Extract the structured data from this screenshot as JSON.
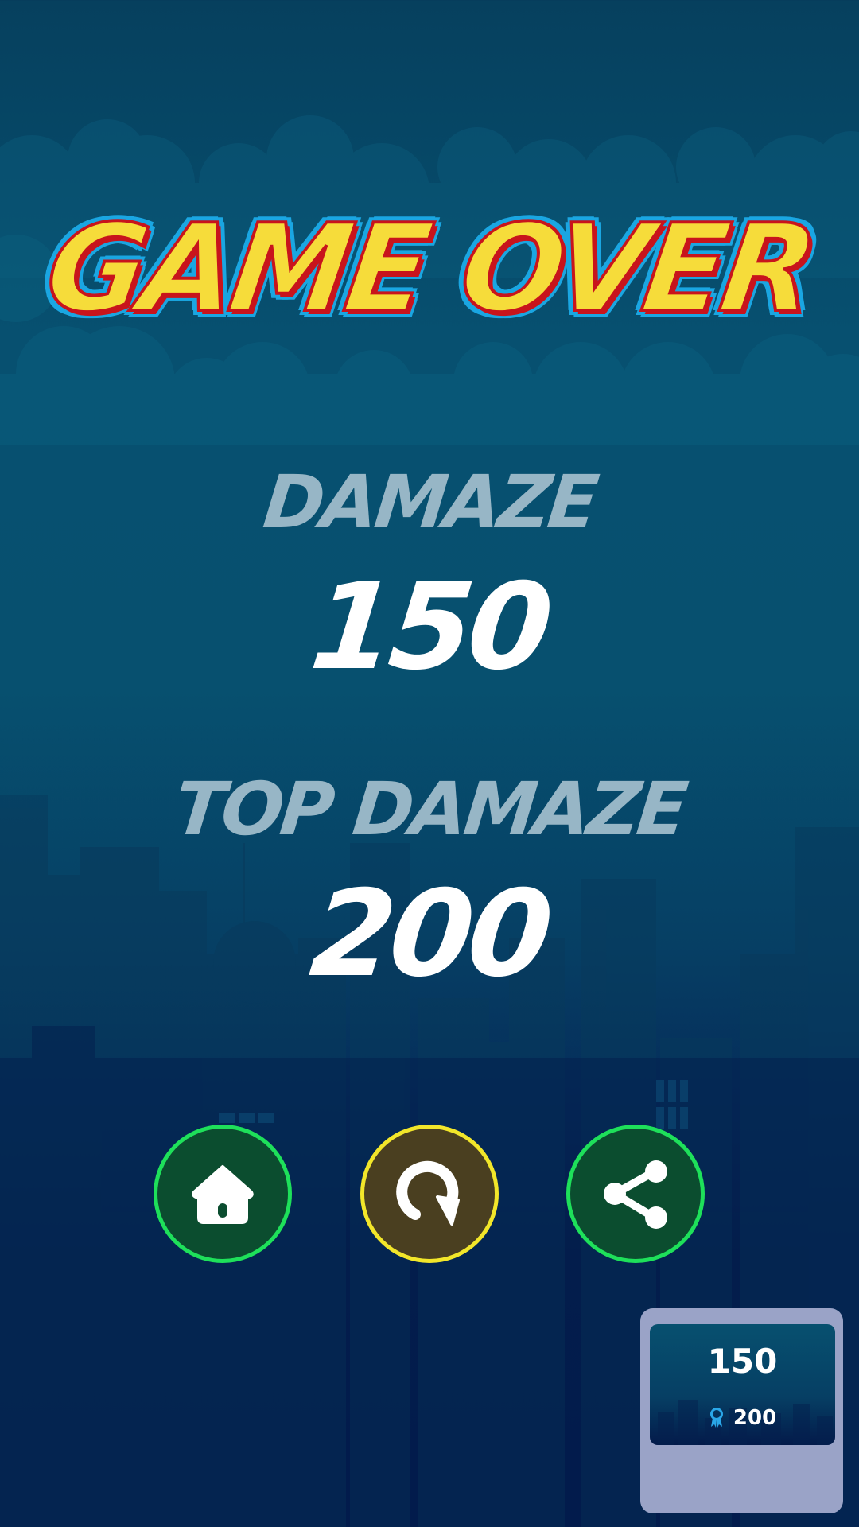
{
  "screen": {
    "title": "GAME OVER",
    "score_label": "DAMAZE",
    "score_value": "150",
    "top_label": "TOP DAMAZE",
    "top_value": "200"
  },
  "buttons": [
    {
      "id": "home",
      "icon": "home-icon",
      "ring_color": "#1ee05a"
    },
    {
      "id": "restart",
      "icon": "restart-icon",
      "ring_color": "#f2e62a"
    },
    {
      "id": "share",
      "icon": "share-icon",
      "ring_color": "#1ee05a"
    }
  ],
  "preview_card": {
    "score": "150",
    "top_score": "200",
    "icon": "medal-icon"
  },
  "colors": {
    "title_fill": "#f6dc3a",
    "title_outline": "#c8141c",
    "title_glow": "#1aa6e2",
    "label": "#97b6c6",
    "value": "#ffffff"
  }
}
